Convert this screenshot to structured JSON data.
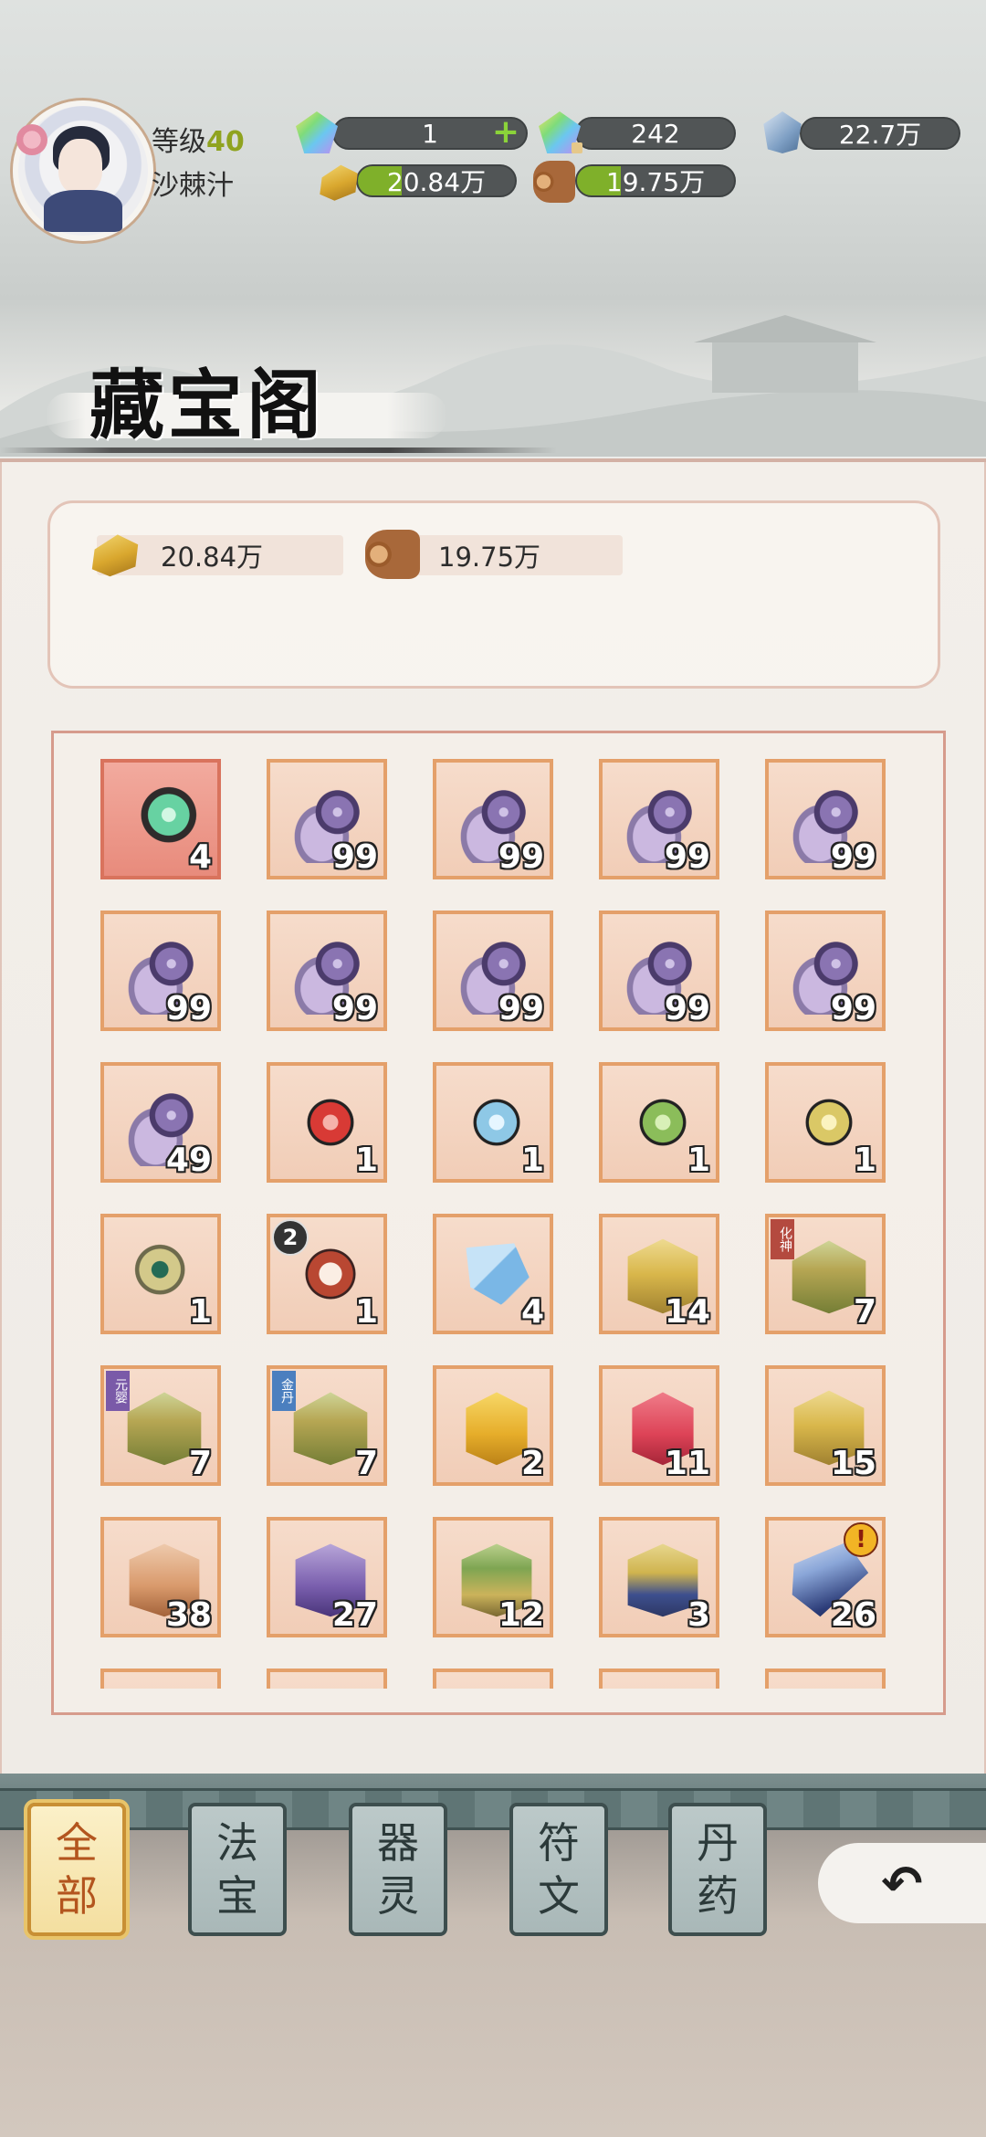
{
  "player": {
    "level_label": "等级",
    "level": "40",
    "name": "沙棘汁"
  },
  "resources": {
    "jade_top": "1",
    "gem_locked": "242",
    "crystal": "22.7万",
    "gold": "20.84万",
    "wood": "19.75万"
  },
  "title": "藏宝阁",
  "summary": {
    "gold": "20.84万",
    "wood": "19.75万"
  },
  "items": [
    {
      "icon": "jade-orb",
      "count": "4",
      "selected": true
    },
    {
      "icon": "purple-pearl",
      "count": "99"
    },
    {
      "icon": "purple-pearl",
      "count": "99"
    },
    {
      "icon": "purple-pearl",
      "count": "99"
    },
    {
      "icon": "purple-pearl",
      "count": "99"
    },
    {
      "icon": "purple-pearl",
      "count": "99"
    },
    {
      "icon": "purple-pearl",
      "count": "99"
    },
    {
      "icon": "purple-pearl",
      "count": "99"
    },
    {
      "icon": "purple-pearl",
      "count": "99"
    },
    {
      "icon": "purple-pearl",
      "count": "99"
    },
    {
      "icon": "purple-pearl",
      "count": "49"
    },
    {
      "icon": "red-orb",
      "count": "1"
    },
    {
      "icon": "blue-orb",
      "count": "1"
    },
    {
      "icon": "green-orb",
      "count": "1"
    },
    {
      "icon": "yellow-orb",
      "count": "1"
    },
    {
      "icon": "jade-amulet",
      "count": "1"
    },
    {
      "icon": "red-armor",
      "count": "1",
      "badge": "2"
    },
    {
      "icon": "blue-cloth",
      "count": "4"
    },
    {
      "icon": "scroll-chest",
      "count": "14"
    },
    {
      "icon": "treasure-chest",
      "count": "7",
      "tag": "化神"
    },
    {
      "icon": "treasure-chest",
      "count": "7",
      "tag": "元婴"
    },
    {
      "icon": "treasure-chest",
      "count": "7",
      "tag": "金丹"
    },
    {
      "icon": "yellow-gift",
      "count": "2"
    },
    {
      "icon": "red-gift",
      "count": "11"
    },
    {
      "icon": "gold-chest",
      "count": "15"
    },
    {
      "icon": "bronze-chest",
      "count": "38"
    },
    {
      "icon": "purple-chest",
      "count": "27"
    },
    {
      "icon": "green-gold-chest",
      "count": "12"
    },
    {
      "icon": "blue-gold-chest",
      "count": "3"
    },
    {
      "icon": "blue-scroll",
      "count": "26",
      "alert": "!"
    }
  ],
  "tabs": [
    {
      "label_top": "全",
      "label_bottom": "部",
      "active": true
    },
    {
      "label_top": "法",
      "label_bottom": "宝"
    },
    {
      "label_top": "器",
      "label_bottom": "灵"
    },
    {
      "label_top": "符",
      "label_bottom": "文"
    },
    {
      "label_top": "丹",
      "label_bottom": "药"
    }
  ],
  "back_button": "↶"
}
